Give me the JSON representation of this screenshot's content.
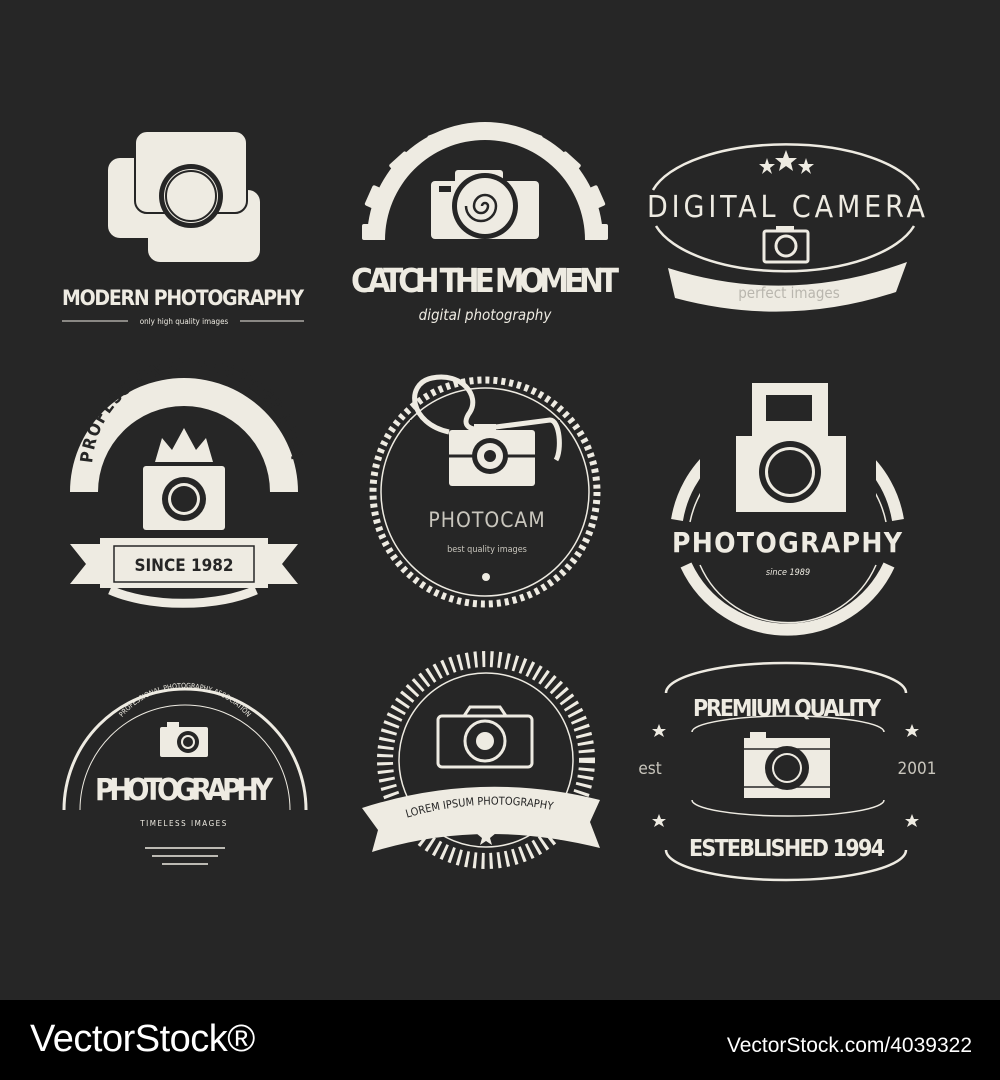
{
  "colors": {
    "background": "#262626",
    "ink": "#eeebe2",
    "footer": "#000000"
  },
  "badges": [
    {
      "title": "MODERN PHOTOGRAPHY",
      "subtitle": "only high quality images",
      "icon": "overlapping-camera-frames-icon"
    },
    {
      "title": "CATCH THE MOMENT",
      "subtitle": "digital photography",
      "icon": "gear-camera-icon"
    },
    {
      "title": "DIGITAL CAMERA",
      "subtitle": "perfect images",
      "icon": "camera-icon"
    },
    {
      "title": "PROFESSIONAL PHOTOGRAPHY",
      "ribbon": "SINCE 1982",
      "icon": "crown-camera-icon"
    },
    {
      "title": "PHOTOCAM",
      "subtitle": "best quality images",
      "icon": "strap-camera-icon"
    },
    {
      "title": "PHOTOGRAPHY",
      "subtitle": "since 1989",
      "icon": "instant-camera-icon"
    },
    {
      "arc_text": "PROFESSIONAL PHOTOGRAPHY ASSOCIATION",
      "title": "PHOTOGRAPHY",
      "subtitle": "TIMELESS IMAGES",
      "icon": "camera-icon"
    },
    {
      "ribbon": "LOREM IPSUM PHOTOGRAPHY",
      "icon": "camera-outline-icon"
    },
    {
      "title": "PREMIUM QUALITY",
      "left": "est",
      "right": "2001",
      "bottom": "ESTEBLISHED 1994",
      "icon": "camera-icon"
    }
  ],
  "footer": {
    "brand": "VectorStock®",
    "id": "VectorStock.com/4039322"
  }
}
